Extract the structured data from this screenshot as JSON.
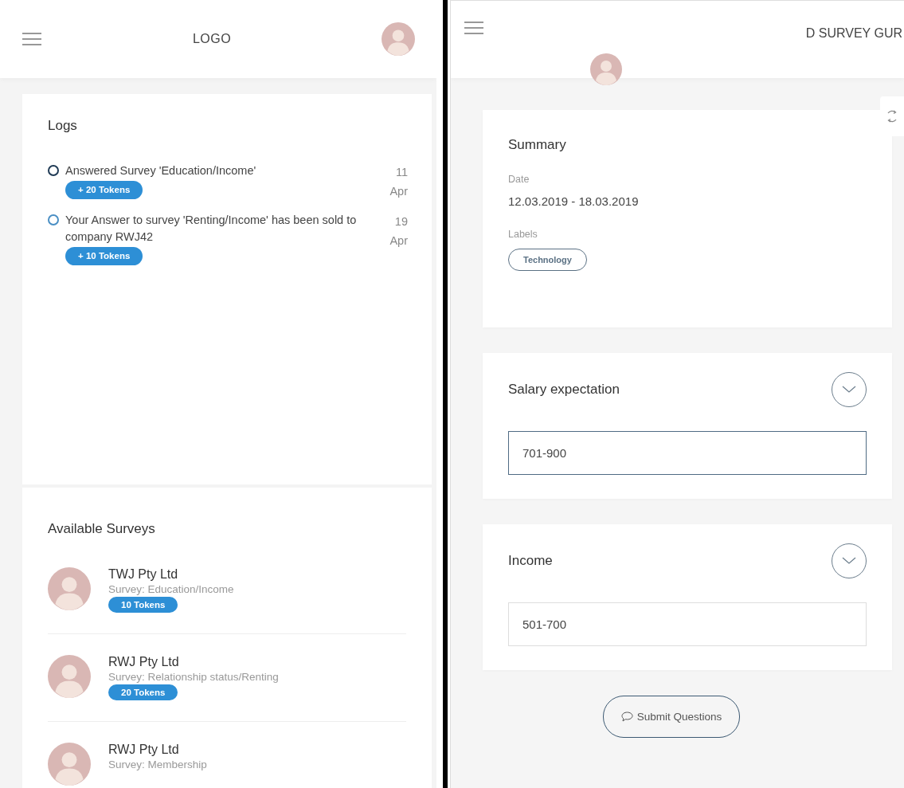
{
  "left": {
    "logo": "LOGO",
    "logs": {
      "title": "Logs",
      "items": [
        {
          "text": "Answered Survey 'Education/Income'",
          "tokens": "+ 20 Tokens",
          "date": "11 Apr",
          "color": "#1f3a55"
        },
        {
          "text": "Your Answer to survey 'Renting/Income' has been sold to company RWJ42",
          "tokens": "+ 10 Tokens",
          "date": "19 Apr",
          "color": "#4a8fc4"
        }
      ]
    },
    "available_surveys": {
      "title": "Available Surveys",
      "items": [
        {
          "company": "TWJ Pty Ltd",
          "survey": "Survey: Education/Income",
          "tokens": "10 Tokens"
        },
        {
          "company": "RWJ Pty Ltd",
          "survey": "Survey: Relationship status/Renting",
          "tokens": "20 Tokens"
        },
        {
          "company": "RWJ Pty Ltd",
          "survey": "Survey: Membership"
        }
      ]
    }
  },
  "right": {
    "title": "D SURVEY GUR",
    "summary": {
      "title": "Summary",
      "date_label": "Date",
      "date": "12.03.2019 - 18.03.2019",
      "labels_label": "Labels",
      "labels": [
        "Technology"
      ]
    },
    "questions": [
      {
        "label": "Salary expectation",
        "value": "701-900",
        "focused": true
      },
      {
        "label": "Income",
        "value": "501-700",
        "focused": false
      }
    ],
    "submit_button": "Submit Questions"
  }
}
